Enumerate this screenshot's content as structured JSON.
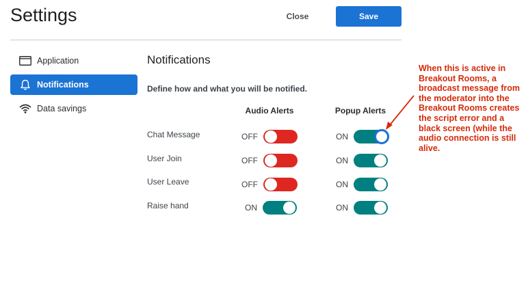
{
  "header": {
    "title": "Settings",
    "close_label": "Close",
    "save_label": "Save"
  },
  "sidebar": {
    "items": [
      {
        "label": "Application",
        "icon": "application-window-icon",
        "active": false
      },
      {
        "label": "Notifications",
        "icon": "bell-icon",
        "active": true
      },
      {
        "label": "Data savings",
        "icon": "wifi-icon",
        "active": false
      }
    ]
  },
  "main": {
    "title": "Notifications",
    "description": "Define how and what you will be notified.",
    "columns": [
      "Audio Alerts",
      "Popup Alerts"
    ],
    "rows": [
      {
        "label": "Chat Message",
        "audio": "OFF",
        "popup": "ON"
      },
      {
        "label": "User Join",
        "audio": "OFF",
        "popup": "ON"
      },
      {
        "label": "User Leave",
        "audio": "OFF",
        "popup": "ON"
      },
      {
        "label": "Raise hand",
        "audio": "ON",
        "popup": "ON"
      }
    ]
  },
  "annotation": {
    "text": "When this is active in Breakout Rooms, a broadcast message from the moderator into the Breakout Rooms creates the script error and a black screen (while the audio connection is still alive.",
    "color": "#d52b0a"
  },
  "colors": {
    "accent": "#1b73d3",
    "toggle_on": "#008081",
    "toggle_off": "#df2721"
  }
}
